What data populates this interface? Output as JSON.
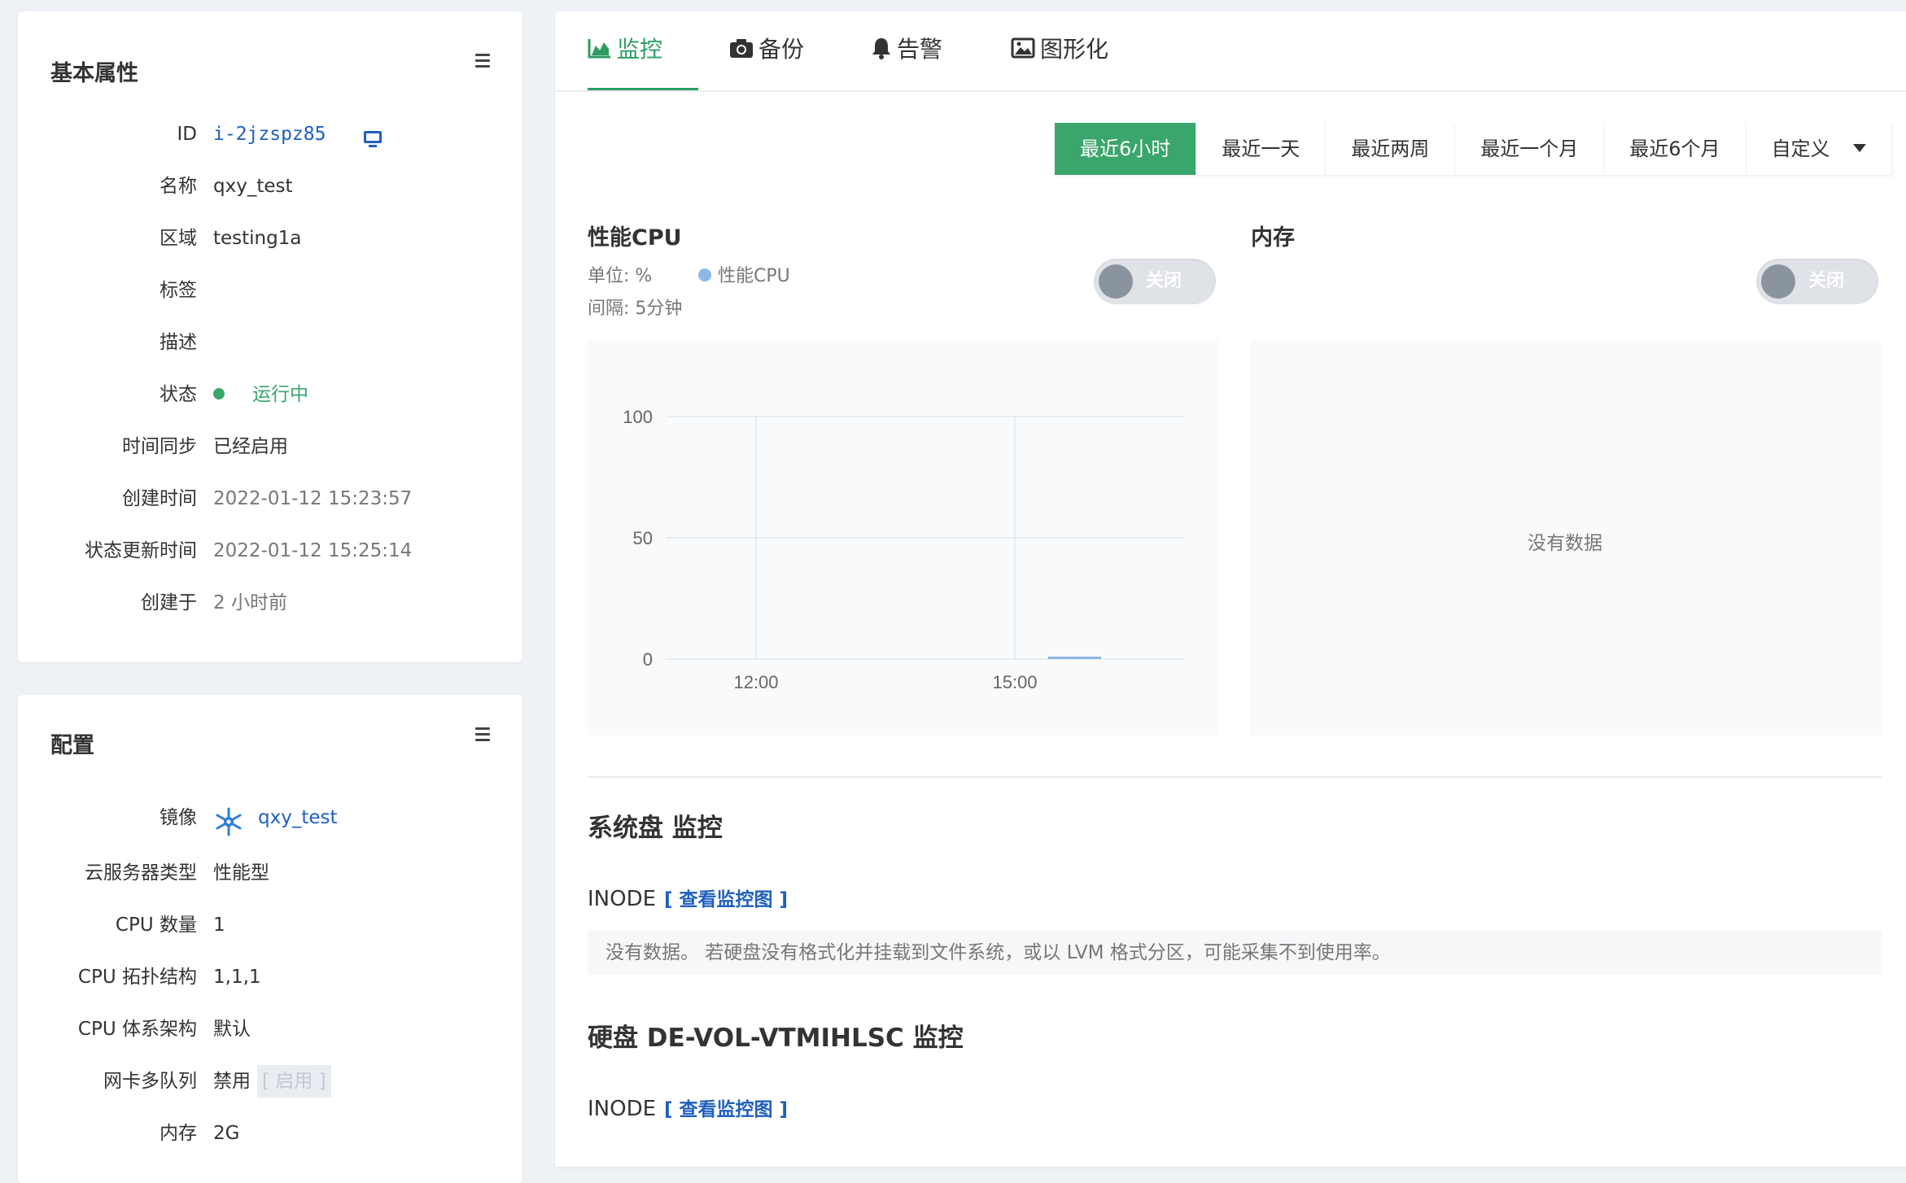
{
  "basic": {
    "title": "基本属性",
    "rows": [
      {
        "label": "ID",
        "value": "i-2jzspz85"
      },
      {
        "label": "名称",
        "value": "qxy_test"
      },
      {
        "label": "区域",
        "value": "testing1a"
      },
      {
        "label": "标签",
        "value": ""
      },
      {
        "label": "描述",
        "value": ""
      },
      {
        "label": "状态",
        "value": "运行中"
      },
      {
        "label": "时间同步",
        "value": "已经启用"
      },
      {
        "label": "创建时间",
        "value": "2022-01-12 15:23:57"
      },
      {
        "label": "状态更新时间",
        "value": "2022-01-12 15:25:14"
      },
      {
        "label": "创建于",
        "value": "2 小时前"
      }
    ]
  },
  "config": {
    "title": "配置",
    "rows": [
      {
        "label": "镜像",
        "value": "qxy_test"
      },
      {
        "label": "云服务器类型",
        "value": "性能型"
      },
      {
        "label": "CPU 数量",
        "value": "1"
      },
      {
        "label": "CPU 拓扑结构",
        "value": "1,1,1"
      },
      {
        "label": "CPU 体系架构",
        "value": "默认"
      },
      {
        "label": "网卡多队列",
        "value": "禁用",
        "extra": "[ 启用 ]"
      },
      {
        "label": "内存",
        "value": "2G"
      }
    ]
  },
  "tabs": [
    {
      "label": "监控",
      "icon": "area-chart-icon"
    },
    {
      "label": "备份",
      "icon": "camera-icon"
    },
    {
      "label": "告警",
      "icon": "bell-icon"
    },
    {
      "label": "图形化",
      "icon": "image-icon"
    }
  ],
  "ranges": [
    "最近6小时",
    "最近一天",
    "最近两周",
    "最近一个月",
    "最近6个月",
    "自定义"
  ],
  "cpu": {
    "title": "性能CPU",
    "unit": "单位: %",
    "legend": "性能CPU",
    "interval": "间隔: 5分钟",
    "toggle": "关闭"
  },
  "memory": {
    "title": "内存",
    "toggle": "关闭",
    "empty": "没有数据"
  },
  "chart_data": {
    "type": "line",
    "title": "性能CPU",
    "xlabel": "",
    "ylabel": "",
    "ylim": [
      0,
      100
    ],
    "yticks": [
      "100",
      "50",
      "0"
    ],
    "xticks": [
      "12:00",
      "15:00"
    ],
    "series": [
      {
        "name": "性能CPU",
        "color": "#8cb8e6",
        "x": [
          "15:23",
          "15:30",
          "15:40",
          "15:50",
          "16:00"
        ],
        "values": [
          0.5,
          0.5,
          0.5,
          0.5,
          0.5
        ]
      }
    ],
    "grid": true
  },
  "sys_disk": {
    "title": "系统盘 监控",
    "inode_label": "INODE",
    "view_link": "[ 查看监控图 ]",
    "empty": "没有数据。 若硬盘没有格式化并挂载到文件系统，或以 LVM 格式分区，可能采集不到使用率。"
  },
  "disk2": {
    "title": "硬盘 DE-VOL-VTMIHLSC 监控",
    "inode_label": "INODE",
    "view_link": "[ 查看监控图 ]"
  }
}
